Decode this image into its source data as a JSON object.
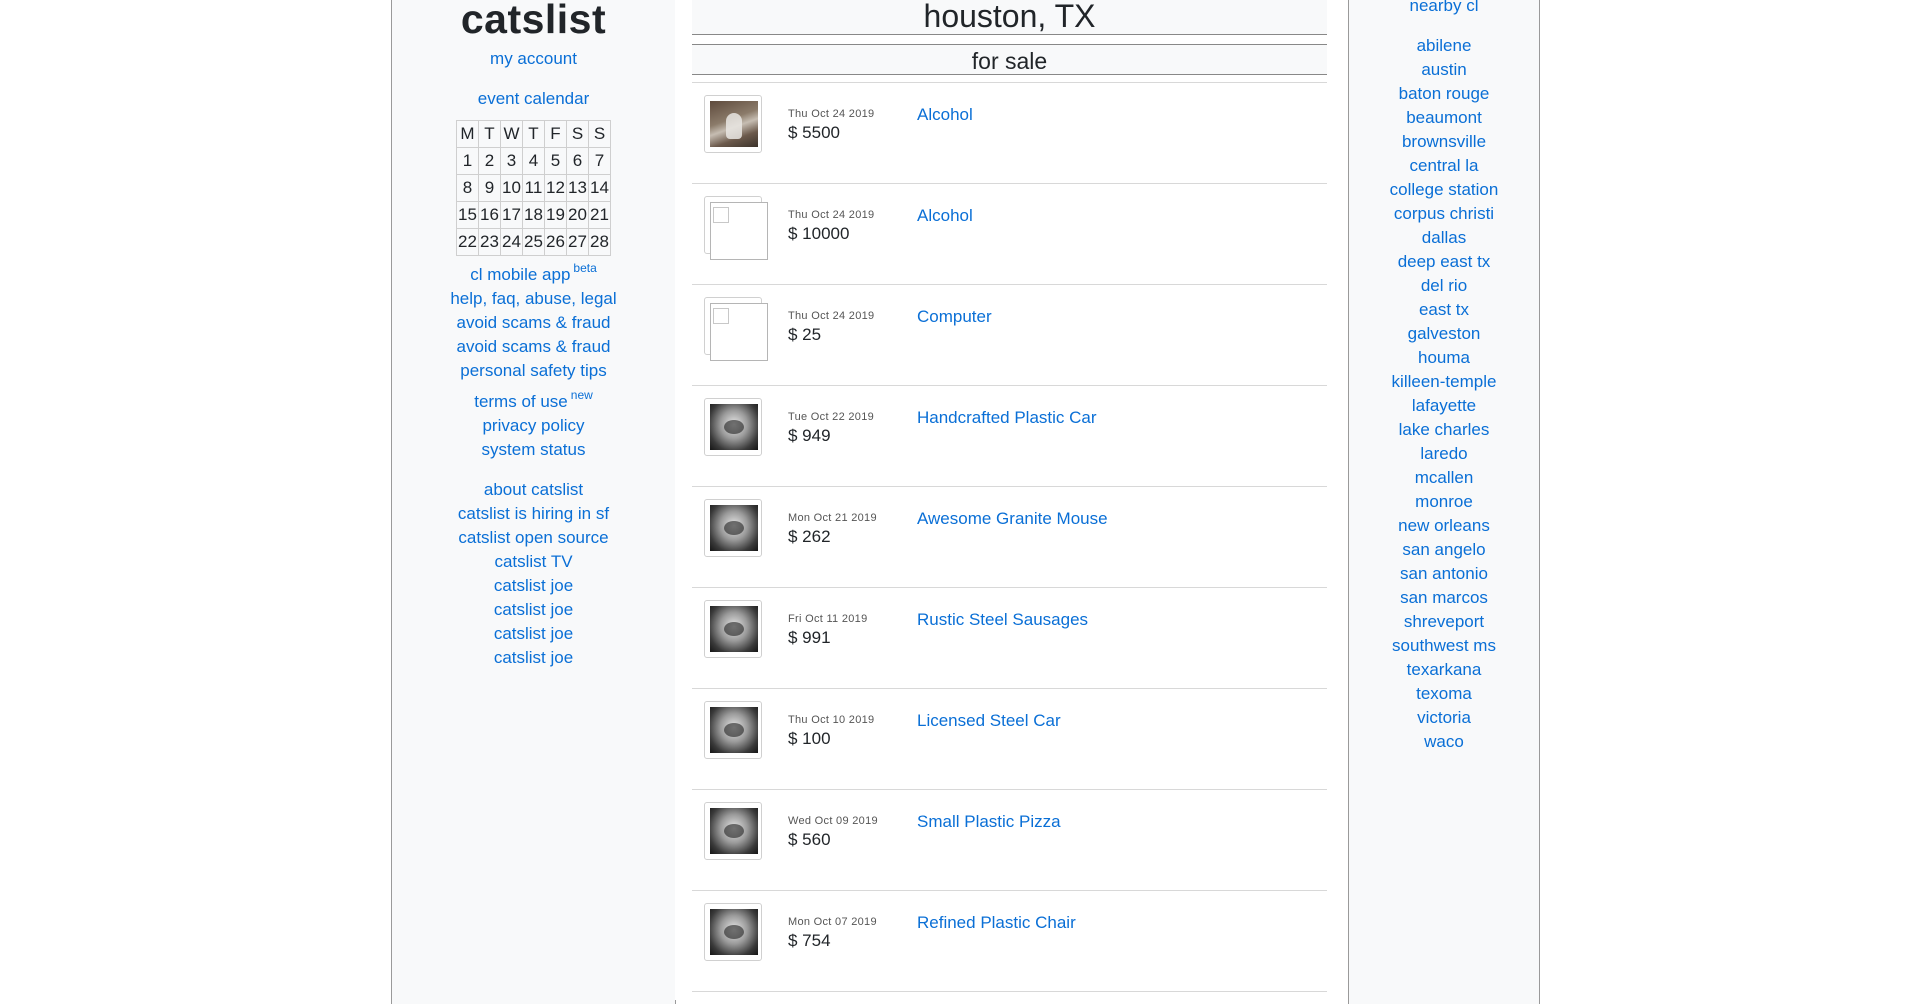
{
  "left": {
    "logo": "catslist",
    "my_account": "my account",
    "event_calendar": "event calendar",
    "calendar": {
      "headers": [
        "M",
        "T",
        "W",
        "T",
        "F",
        "S",
        "S"
      ],
      "weeks": [
        [
          "1",
          "2",
          "3",
          "4",
          "5",
          "6",
          "7"
        ],
        [
          "8",
          "9",
          "10",
          "11",
          "12",
          "13",
          "14"
        ],
        [
          "15",
          "16",
          "17",
          "18",
          "19",
          "20",
          "21"
        ],
        [
          "22",
          "23",
          "24",
          "25",
          "26",
          "27",
          "28"
        ]
      ]
    },
    "mobile_app": "cl mobile app",
    "mobile_app_tag": "beta",
    "help": "help, faq, abuse, legal",
    "scams_1": "avoid scams & fraud",
    "scams_2": "avoid scams & fraud",
    "safety": "personal safety tips",
    "terms": "terms of use",
    "terms_tag": "new",
    "privacy": "privacy policy",
    "status": "system status",
    "about": "about catslist",
    "hiring": "catslist is hiring in sf",
    "open_source": "catslist open source",
    "tv": "catslist TV",
    "joe_1": "catslist joe",
    "joe_2": "catslist joe",
    "joe_3": "catslist joe",
    "joe_4": "catslist joe"
  },
  "center": {
    "city": "houston, TX",
    "section": "for sale",
    "listings": [
      {
        "date": "Thu Oct 24 2019",
        "price": "$ 5500",
        "title": "Alcohol",
        "thumb": "cat-photo"
      },
      {
        "date": "Thu Oct 24 2019",
        "price": "$ 10000",
        "title": "Alcohol",
        "thumb": "broken-image"
      },
      {
        "date": "Thu Oct 24 2019",
        "price": "$ 25",
        "title": "Computer",
        "thumb": "broken-image"
      },
      {
        "date": "Tue Oct 22 2019",
        "price": "$ 949",
        "title": "Handcrafted Plastic Car",
        "thumb": "bw-photo"
      },
      {
        "date": "Mon Oct 21 2019",
        "price": "$ 262",
        "title": "Awesome Granite Mouse",
        "thumb": "bw-photo"
      },
      {
        "date": "Fri Oct 11 2019",
        "price": "$ 991",
        "title": "Rustic Steel Sausages",
        "thumb": "bw-photo"
      },
      {
        "date": "Thu Oct 10 2019",
        "price": "$ 100",
        "title": "Licensed Steel Car",
        "thumb": "bw-photo"
      },
      {
        "date": "Wed Oct 09 2019",
        "price": "$ 560",
        "title": "Small Plastic Pizza",
        "thumb": "bw-photo"
      },
      {
        "date": "Mon Oct 07 2019",
        "price": "$ 754",
        "title": "Refined Plastic Chair",
        "thumb": "bw-photo"
      }
    ]
  },
  "right": {
    "title": "nearby cl",
    "items": [
      "abilene",
      "austin",
      "baton rouge",
      "beaumont",
      "brownsville",
      "central la",
      "college station",
      "corpus christi",
      "dallas",
      "deep east tx",
      "del rio",
      "east tx",
      "galveston",
      "houma",
      "killeen-temple",
      "lafayette",
      "lake charles",
      "laredo",
      "mcallen",
      "monroe",
      "new orleans",
      "san angelo",
      "san antonio",
      "san marcos",
      "shreveport",
      "southwest ms",
      "texarkana",
      "texoma",
      "victoria",
      "waco"
    ]
  },
  "colors": {
    "link": "#0a6fd6",
    "panel": "#f8f9fa",
    "text": "#212529"
  }
}
